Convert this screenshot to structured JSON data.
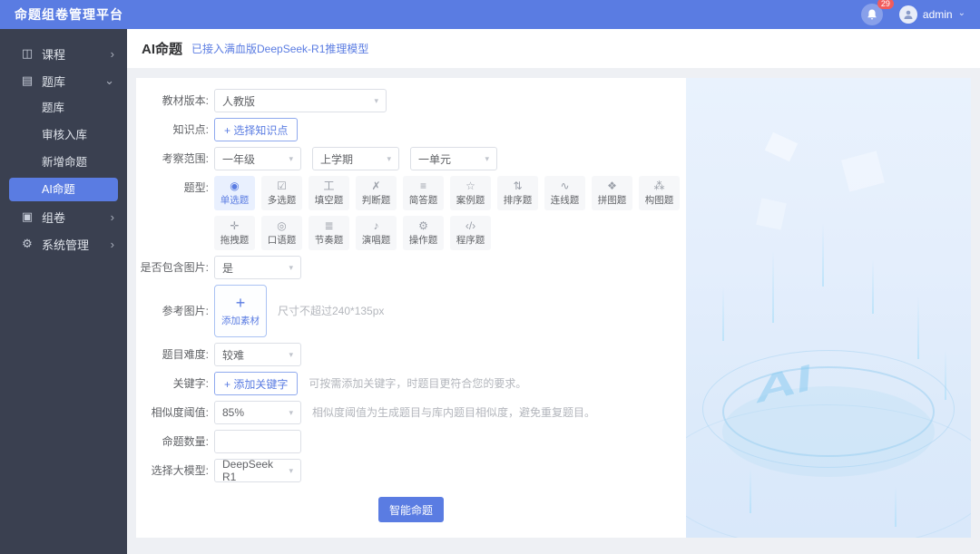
{
  "app": {
    "title": "命题组卷管理平台",
    "notification_count": "29",
    "user": "admin"
  },
  "ui": {
    "select_arrow": "▾",
    "caret_down": "⌄"
  },
  "colors": {
    "accent": "#5a7ce2",
    "header": "#5a7ce2",
    "sidebar": "#3a4050",
    "badge": "#f25c5c",
    "tile_selected_bg": "#e9f0fe"
  },
  "sidebar": {
    "items": [
      {
        "label": "课程",
        "glyph": "◫",
        "arrow": "›"
      },
      {
        "label": "题库",
        "glyph": "▤",
        "arrow": "⌄"
      },
      {
        "label": "组卷",
        "glyph": "▣",
        "arrow": "›"
      },
      {
        "label": "系统管理",
        "glyph": "⚙",
        "arrow": "›"
      }
    ],
    "submenu": [
      {
        "label": "题库"
      },
      {
        "label": "审核入库"
      },
      {
        "label": "新增命题"
      },
      {
        "label": "AI命题"
      }
    ],
    "active_item": "AI命题"
  },
  "page": {
    "title": "AI命题",
    "subtitle": "已接入满血版DeepSeek-R1推理模型"
  },
  "form": {
    "textbook": {
      "label": "教材版本:",
      "value": "人教版"
    },
    "knowledge": {
      "label": "知识点:",
      "button": "+ 选择知识点"
    },
    "scope": {
      "label": "考察范围:",
      "grade": "一年级",
      "term": "上学期",
      "unit": "一单元"
    },
    "types": {
      "label": "题型:",
      "selected": "单选题",
      "items": [
        {
          "label": "单选题",
          "glyph": "◉"
        },
        {
          "label": "多选题",
          "glyph": "☑"
        },
        {
          "label": "填空题",
          "glyph": "工"
        },
        {
          "label": "判断题",
          "glyph": "✗"
        },
        {
          "label": "简答题",
          "glyph": "≡"
        },
        {
          "label": "案例题",
          "glyph": "☆"
        },
        {
          "label": "排序题",
          "glyph": "⇅"
        },
        {
          "label": "连线题",
          "glyph": "∿"
        },
        {
          "label": "拼图题",
          "glyph": "❖"
        },
        {
          "label": "构图题",
          "glyph": "⁂"
        },
        {
          "label": "拖拽题",
          "glyph": "✛"
        },
        {
          "label": "口语题",
          "glyph": "◎"
        },
        {
          "label": "节奏题",
          "glyph": "≣"
        },
        {
          "label": "演唱题",
          "glyph": "♪"
        },
        {
          "label": "操作题",
          "glyph": "⚙"
        },
        {
          "label": "程序题",
          "glyph": "‹/›"
        }
      ]
    },
    "include_image": {
      "label": "是否包含图片:",
      "value": "是"
    },
    "reference_image": {
      "label": "参考图片:",
      "plus": "+",
      "button_text": "添加素材",
      "hint": "尺寸不超过240*135px"
    },
    "difficulty": {
      "label": "题目难度:",
      "value": "较难"
    },
    "keywords": {
      "label": "关键字:",
      "button": "+ 添加关键字",
      "hint": "可按需添加关键字，时题目更符合您的要求。"
    },
    "similarity": {
      "label": "相似度阈值:",
      "value": "85%",
      "hint": "相似度阈值为生成题目与库内题目相似度，避免重复题目。"
    },
    "quantity": {
      "label": "命题数量:",
      "value": ""
    },
    "model": {
      "label": "选择大模型:",
      "value": "DeepSeek R1"
    },
    "submit": "智能命题"
  },
  "illustration": {
    "disc_text": "AI"
  }
}
